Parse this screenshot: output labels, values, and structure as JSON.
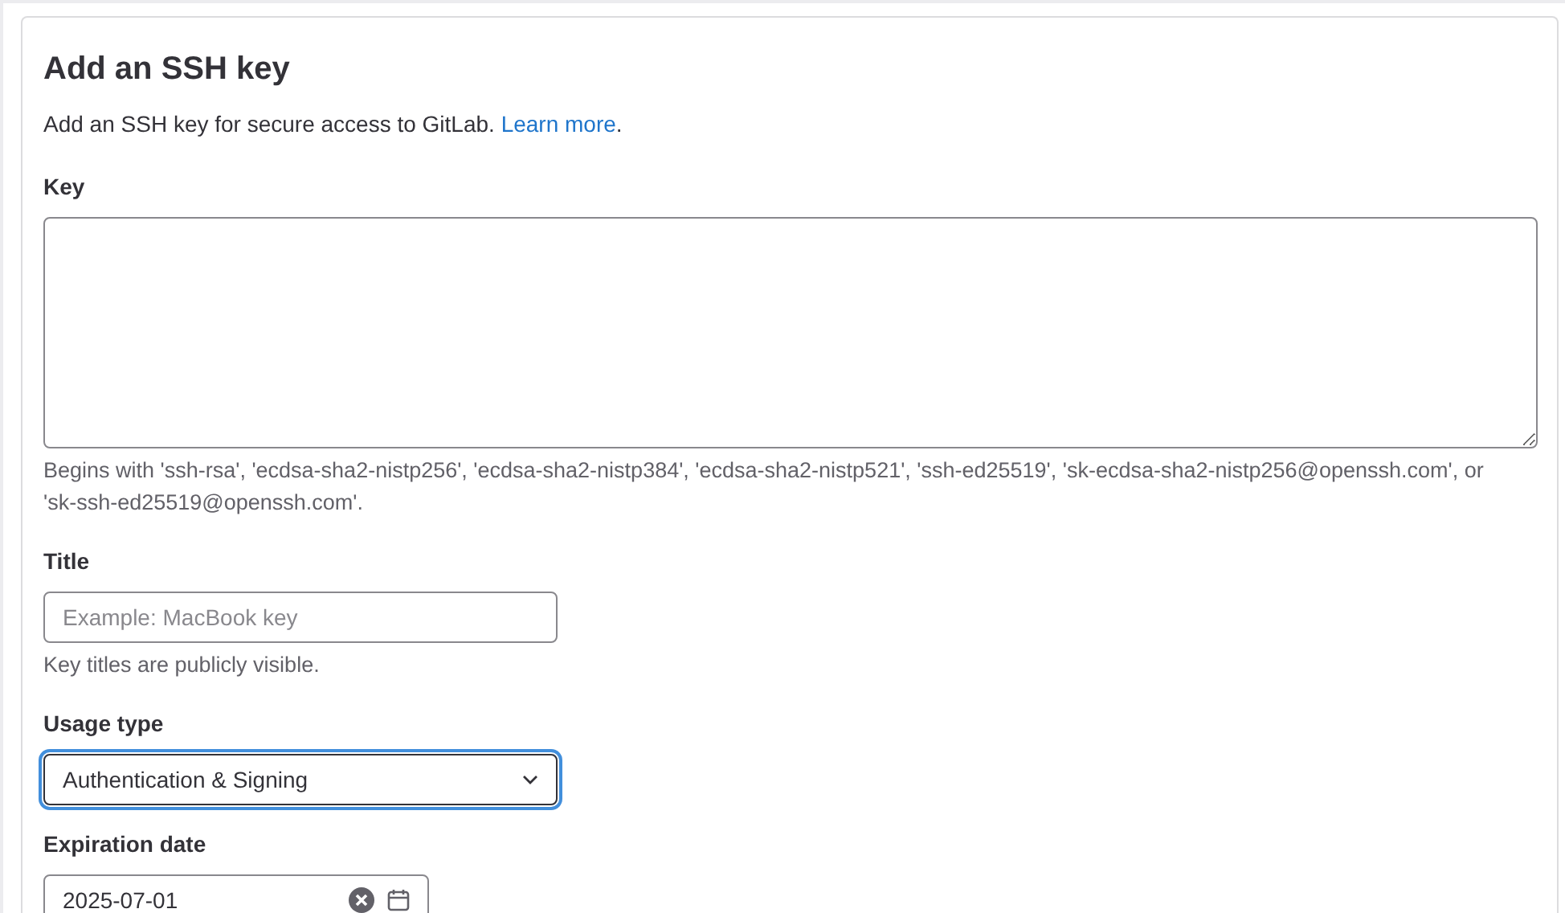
{
  "heading": "Add an SSH key",
  "description": {
    "text": "Add an SSH key for secure access to GitLab.",
    "link": "Learn more",
    "after": "."
  },
  "key": {
    "label": "Key",
    "help": "Begins with 'ssh-rsa', 'ecdsa-sha2-nistp256', 'ecdsa-sha2-nistp384', 'ecdsa-sha2-nistp521', 'ssh-ed25519', 'sk-ecdsa-sha2-nistp256@openssh.com', or 'sk-ssh-ed25519@openssh.com'."
  },
  "title": {
    "label": "Title",
    "placeholder": "Example: MacBook key",
    "help": "Key titles are publicly visible."
  },
  "usage_type": {
    "label": "Usage type",
    "value": "Authentication & Signing",
    "focused": true
  },
  "expiration_date": {
    "label": "Expiration date",
    "value": "2025-07-01"
  }
}
